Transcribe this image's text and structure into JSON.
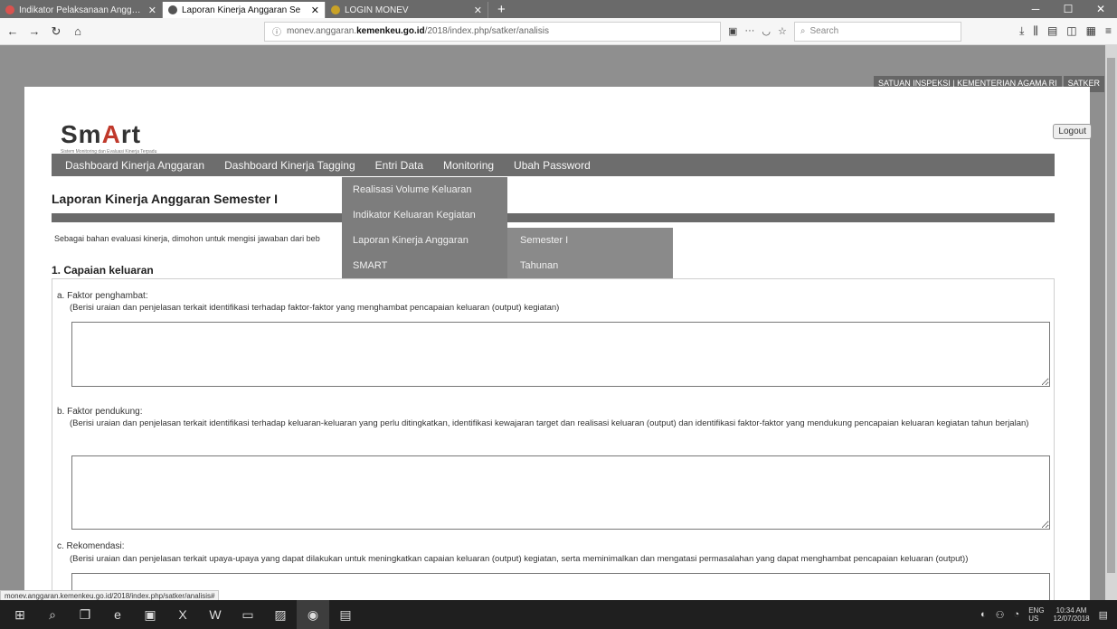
{
  "browser": {
    "tabs": [
      {
        "label": "Indikator Pelaksanaan Anggaran Ti",
        "favicon_color": "#d9534f",
        "active": false
      },
      {
        "label": "Laporan Kinerja Anggaran Se",
        "favicon_color": "#555555",
        "active": true
      },
      {
        "label": "LOGIN MONEV",
        "favicon_color": "#c9a227",
        "active": false
      }
    ],
    "new_tab": "+",
    "url_prefix": "monev.anggaran.",
    "url_domain": "kemenkeu.go.id",
    "url_suffix": "/2018/index.php/satker/analisis",
    "url_actions": "···",
    "search_placeholder": "Search"
  },
  "header": {
    "user_info": "SATUAN INSPEKSI | KEMENTERIAN AGAMA RI",
    "user_tag": "SATKER",
    "logout": "Logout",
    "logo_left": "Sm",
    "logo_accent": "A",
    "logo_right": "rt",
    "logo_subtitle": "Sistem Monitoring dan Evaluasi Kinerja Terpadu Anggaran Anggaran"
  },
  "menu": {
    "items": [
      "Dashboard Kinerja Anggaran",
      "Dashboard Kinerja Tagging",
      "Entri Data",
      "Monitoring",
      "Ubah Password"
    ],
    "dropdown": [
      "Realisasi Volume Keluaran",
      "Indikator Keluaran Kegiatan",
      "Laporan Kinerja Anggaran",
      "SMART"
    ],
    "submenu": [
      "Semester I",
      "Tahunan"
    ]
  },
  "main": {
    "title": "Laporan Kinerja Anggaran Semester I",
    "intro": "Sebagai bahan evaluasi kinerja, dimohon untuk mengisi jawaban dari beb",
    "section1": "1. Capaian keluaran",
    "questions": [
      {
        "label": "a. Faktor penghambat:",
        "desc": "(Berisi uraian dan penjelasan terkait identifikasi terhadap faktor-faktor yang menghambat pencapaian keluaran (output) kegiatan)"
      },
      {
        "label": "b. Faktor pendukung:",
        "desc": "(Berisi uraian dan penjelasan terkait identifikasi terhadap keluaran-keluaran yang perlu ditingkatkan, identifikasi kewajaran target dan realisasi keluaran (output) dan identifikasi faktor-faktor yang mendukung pencapaian keluaran kegiatan tahun berjalan)"
      },
      {
        "label": "c. Rekomendasi:",
        "desc": "(Berisi uraian dan penjelasan terkait upaya-upaya yang dapat dilakukan untuk meningkatkan capaian keluaran (output) kegiatan, serta meminimalkan dan mengatasi permasalahan yang dapat menghambat pencapaian keluaran (output))"
      }
    ]
  },
  "status_url": "monev.anggaran.kemenkeu.go.id/2018/index.php/satker/analisis#",
  "taskbar": {
    "lang": "ENG",
    "lang2": "US",
    "time": "10:34 AM",
    "date": "12/07/2018"
  }
}
